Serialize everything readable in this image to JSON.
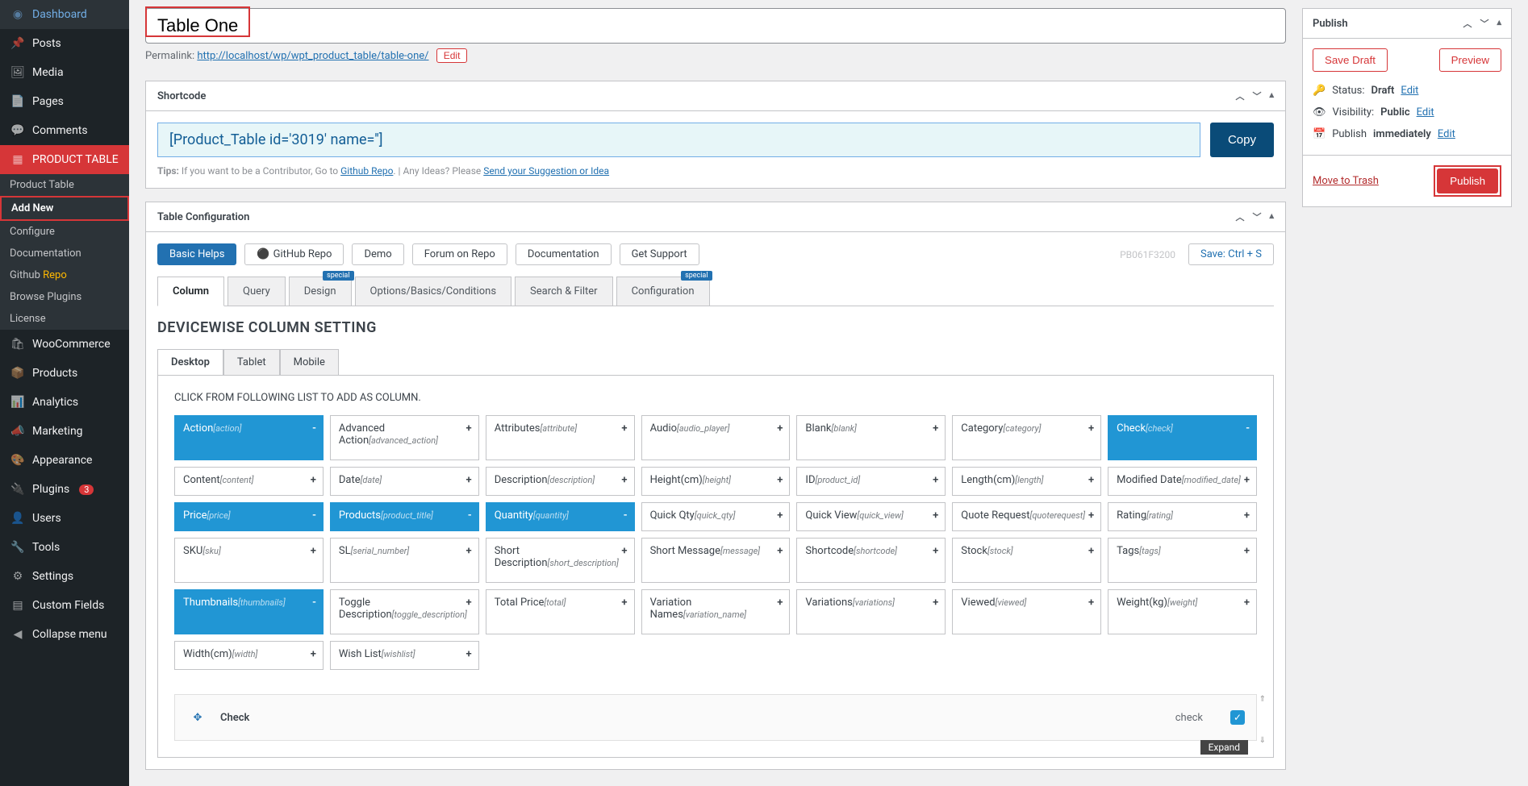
{
  "sidebar": {
    "items": [
      {
        "label": "Dashboard"
      },
      {
        "label": "Posts"
      },
      {
        "label": "Media"
      },
      {
        "label": "Pages"
      },
      {
        "label": "Comments"
      },
      {
        "label": "PRODUCT TABLE"
      },
      {
        "label": "WooCommerce"
      },
      {
        "label": "Products"
      },
      {
        "label": "Analytics"
      },
      {
        "label": "Marketing"
      },
      {
        "label": "Appearance"
      },
      {
        "label": "Plugins"
      },
      {
        "label": "Users"
      },
      {
        "label": "Tools"
      },
      {
        "label": "Settings"
      },
      {
        "label": "Custom Fields"
      },
      {
        "label": "Collapse menu"
      }
    ],
    "sub": [
      {
        "label": "Product Table"
      },
      {
        "label": "Add New"
      },
      {
        "label": "Configure"
      },
      {
        "label": "Documentation"
      },
      {
        "label_pre": "Github ",
        "label_hi": "Repo"
      },
      {
        "label": "Browse Plugins"
      },
      {
        "label": "License"
      }
    ],
    "plugin_badge": "3"
  },
  "title": "Table One",
  "permalink": {
    "label": "Permalink:",
    "url": "http://localhost/wp/wpt_product_table/table-one/",
    "edit": "Edit"
  },
  "shortcode": {
    "title": "Shortcode",
    "value": "[Product_Table id='3019' name='']",
    "copy": "Copy",
    "tips_label": "Tips:",
    "tips_text": " If you want to be a Contributor, Go to ",
    "tips_link": "Github Repo",
    "tips_mid": ". | Any Ideas? Please ",
    "tips_link2": "Send your Suggestion or Idea"
  },
  "config": {
    "title": "Table Configuration",
    "pills": [
      "Basic Helps",
      "GitHub Repo",
      "Demo",
      "Forum on Repo",
      "Documentation",
      "Get Support"
    ],
    "pbcode": "PB061F3200",
    "save": "Save: Ctrl + S",
    "tabs": [
      "Column",
      "Query",
      "Design",
      "Options/Basics/Conditions",
      "Search & Filter",
      "Configuration"
    ],
    "special": "special",
    "section_title": "DEVICEWISE COLUMN SETTING",
    "device_tabs": [
      "Desktop",
      "Tablet",
      "Mobile"
    ],
    "col_hint": "CLICK FROM FOLLOWING LIST TO ADD AS COLUMN.",
    "chips": [
      [
        {
          "l": "Action",
          "s": "[action]",
          "sel": true
        },
        {
          "l": "Advanced Action",
          "s": "[advanced_action]",
          "tall": true
        },
        {
          "l": "Attributes",
          "s": "[attribute]"
        },
        {
          "l": "Audio",
          "s": "[audio_player]"
        },
        {
          "l": "Blank",
          "s": "[blank]"
        },
        {
          "l": "Category",
          "s": "[category]"
        },
        {
          "l": "Check",
          "s": "[check]",
          "sel": true
        }
      ],
      [
        {
          "l": "Content",
          "s": "[content]"
        },
        {
          "l": "Date",
          "s": "[date]"
        },
        {
          "l": "Description",
          "s": "[description]"
        },
        {
          "l": "Height(cm)",
          "s": "[height]"
        },
        {
          "l": "ID",
          "s": "[product_id]"
        },
        {
          "l": "Length(cm)",
          "s": "[length]"
        },
        {
          "l": "Modified Date",
          "s": "[modified_date]"
        }
      ],
      [
        {
          "l": "Price",
          "s": "[price]",
          "sel": true
        },
        {
          "l": "Products",
          "s": "[product_title]",
          "sel": true
        },
        {
          "l": "Quantity",
          "s": "[quantity]",
          "sel": true
        },
        {
          "l": "Quick Qty",
          "s": "[quick_qty]"
        },
        {
          "l": "Quick View",
          "s": "[quick_view]"
        },
        {
          "l": "Quote Request",
          "s": "[quoterequest]"
        },
        {
          "l": "Rating",
          "s": "[rating]"
        }
      ],
      [
        {
          "l": "SKU",
          "s": "[sku]"
        },
        {
          "l": "SL",
          "s": "[serial_number]"
        },
        {
          "l": "Short Description",
          "s": "[short_description]",
          "tall": true
        },
        {
          "l": "Short Message",
          "s": "[message]"
        },
        {
          "l": "Shortcode",
          "s": "[shortcode]"
        },
        {
          "l": "Stock",
          "s": "[stock]"
        },
        {
          "l": "Tags",
          "s": "[tags]"
        }
      ],
      [
        {
          "l": "Thumbnails",
          "s": "[thumbnails]",
          "sel": true
        },
        {
          "l": "Toggle Description",
          "s": "[toggle_description]",
          "tall": true
        },
        {
          "l": "Total Price",
          "s": "[total]"
        },
        {
          "l": "Variation Names",
          "s": "[variation_name]",
          "tall": true
        },
        {
          "l": "Variations",
          "s": "[variations]"
        },
        {
          "l": "Viewed",
          "s": "[viewed]"
        },
        {
          "l": "Weight(kg)",
          "s": "[weight]"
        }
      ],
      [
        {
          "l": "Width(cm)",
          "s": "[width]"
        },
        {
          "l": "Wish List",
          "s": "[wishlist]"
        }
      ]
    ],
    "check_label": "Check",
    "check_right": "check",
    "expand": "Expand"
  },
  "publish": {
    "title": "Publish",
    "save_draft": "Save Draft",
    "preview": "Preview",
    "status_label": "Status:",
    "status_value": "Draft",
    "visibility_label": "Visibility:",
    "visibility_value": "Public",
    "publish_label": "Publish",
    "publish_when": "immediately",
    "edit": "Edit",
    "trash": "Move to Trash",
    "publish_btn": "Publish"
  }
}
